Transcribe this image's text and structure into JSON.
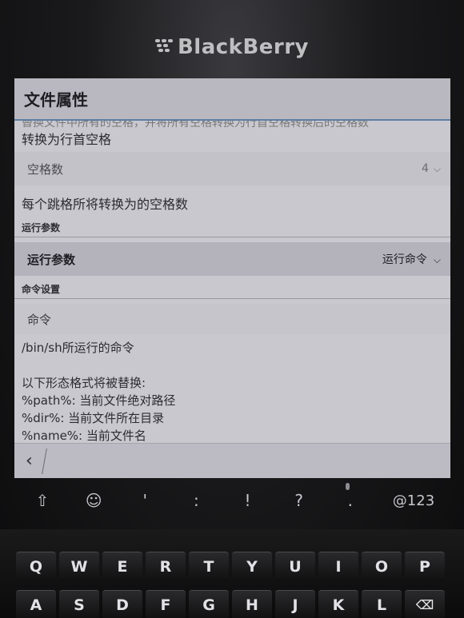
{
  "device": {
    "brand": "BlackBerry"
  },
  "app": {
    "title": "文件属性"
  },
  "content": {
    "cutoff_line": "替换文件中所有的空格，并将所有空格转换为行首空格转换后的空格数",
    "tab_convert_text": "转换为行首空格",
    "spaces_row": {
      "label": "空格数",
      "value": "4"
    },
    "spaces_help": "每个跳格所将转换为的空格数",
    "section_run": "运行参数",
    "run_row": {
      "label": "运行参数",
      "value": "运行命令"
    },
    "section_cmd": "命令设置",
    "cmd_placeholder": "命令",
    "help_lines": [
      "/bin/sh所运行的命令",
      "",
      "以下形态格式将被替换:",
      "%path%: 当前文件绝对路径",
      "%dir%: 当前文件所在目录",
      "%name%: 当前文件名"
    ]
  },
  "bottombar": {
    "back_icon": "back-icon"
  },
  "symbol_row": [
    "⇧",
    "☺",
    "'",
    ":",
    "!",
    "?",
    ".",
    "@123"
  ],
  "keyboard": {
    "row1": [
      "Q",
      "W",
      "E",
      "R",
      "T",
      "Y",
      "U",
      "I",
      "O",
      "P"
    ],
    "row2": [
      "A",
      "S",
      "D",
      "F",
      "G",
      "H",
      "J",
      "K",
      "L",
      "⌫"
    ]
  },
  "colors": {
    "accent": "#5c7fa3",
    "screen_bg": "#c9c8cf"
  }
}
